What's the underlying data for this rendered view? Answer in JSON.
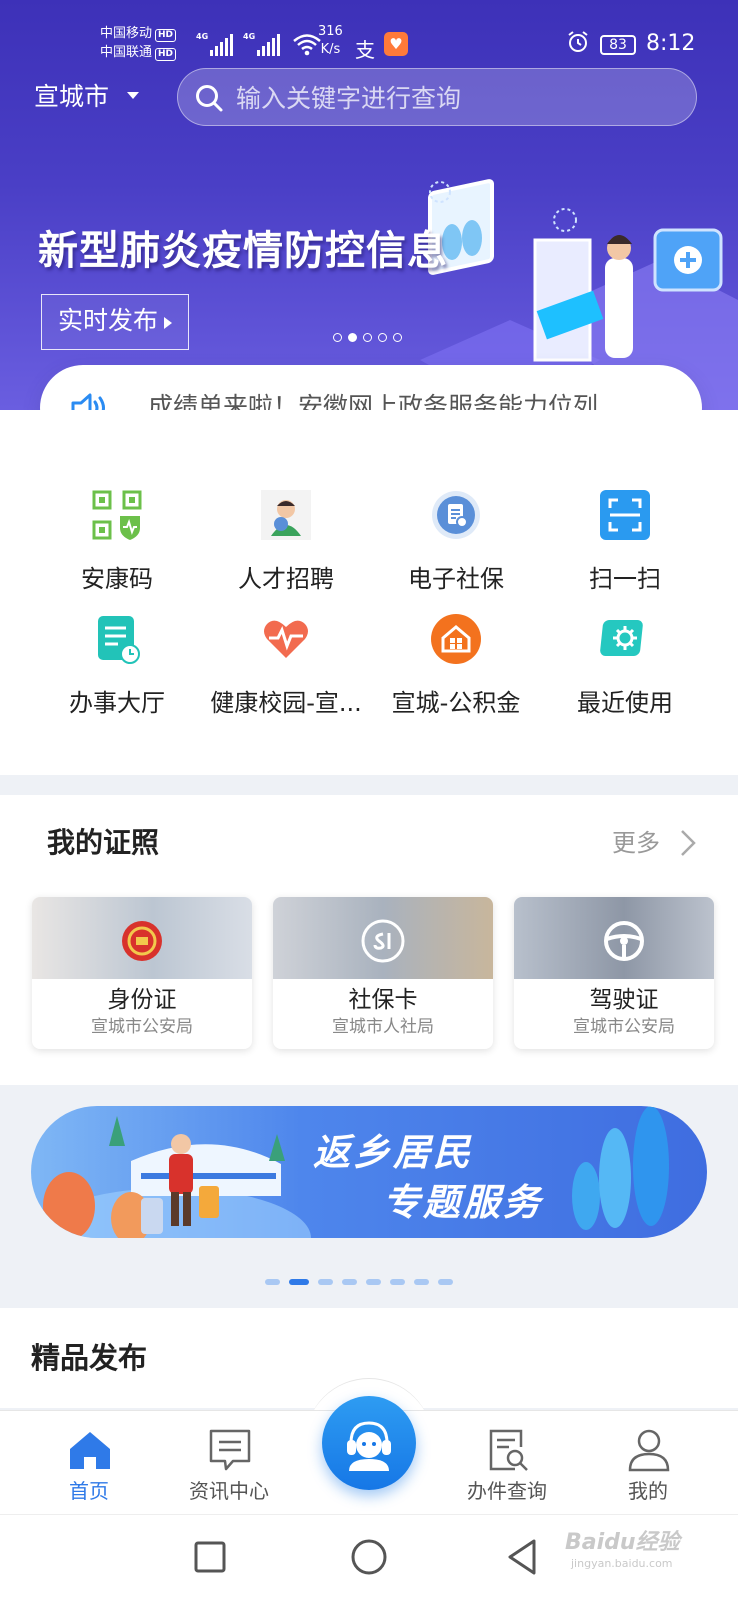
{
  "status_bar": {
    "carrier_1": "中国移动",
    "carrier_2": "中国联通",
    "hd_badge": "HD",
    "network_1": "4G",
    "network_2": "4G",
    "speed_value": "316",
    "speed_unit": "K/s",
    "app_icon_1": "支",
    "app_icon_2": "♥",
    "battery": "83",
    "time": "8:12"
  },
  "header": {
    "city": "宣城市",
    "search_placeholder": "输入关键字进行查询"
  },
  "banner": {
    "title": "新型肺炎疫情防控信息",
    "button_label": "实时发布",
    "dot_count": 5,
    "active_dot": 1
  },
  "notice": {
    "text": "成绩单来啦！安徽网上政务服务能力位列..."
  },
  "services": [
    {
      "label": "安康码",
      "icon": "qr-health-code-icon",
      "color": "#6cc04a"
    },
    {
      "label": "人才招聘",
      "icon": "recruit-avatar-icon",
      "color": "#3aa35c"
    },
    {
      "label": "电子社保",
      "icon": "social-security-icon",
      "color": "#5a8fd8"
    },
    {
      "label": "扫一扫",
      "icon": "scan-icon",
      "color": "#2a9af0"
    },
    {
      "label": "办事大厅",
      "icon": "service-hall-icon",
      "color": "#22c3b8"
    },
    {
      "label": "健康校园-宣...",
      "icon": "heart-pulse-icon",
      "color": "#f26b4f"
    },
    {
      "label": "宣城-公积金",
      "icon": "housing-fund-icon",
      "color": "#f3721e"
    },
    {
      "label": "最近使用",
      "icon": "recent-gear-icon",
      "color": "#25c8c0"
    }
  ],
  "licenses": {
    "title": "我的证照",
    "more": "更多",
    "cards": [
      {
        "name": "身份证",
        "org": "宣城市公安局",
        "icon": "national-emblem-icon"
      },
      {
        "name": "社保卡",
        "org": "宣城市人社局",
        "icon": "si-logo-icon"
      },
      {
        "name": "驾驶证",
        "org": "宣城市公安局",
        "icon": "steering-wheel-icon"
      }
    ]
  },
  "promo": {
    "line1": "返乡居民",
    "line2": "专题服务",
    "dot_count": 8,
    "active_dot": 1
  },
  "featured": {
    "title": "精品发布"
  },
  "tabbar": {
    "tabs": [
      {
        "label": "首页",
        "icon": "home-icon",
        "active": true
      },
      {
        "label": "资讯中心",
        "icon": "news-icon",
        "active": false
      },
      {
        "label": "办件查询",
        "icon": "query-doc-icon",
        "active": false
      },
      {
        "label": "我的",
        "icon": "user-icon",
        "active": false
      }
    ],
    "center_icon": "customer-service-icon"
  },
  "watermark": {
    "text": "Baidu经验",
    "sub": "jingyan.baidu.com"
  },
  "colors": {
    "header_bg": "#3d31b8",
    "accent_blue": "#2f7ae8"
  }
}
